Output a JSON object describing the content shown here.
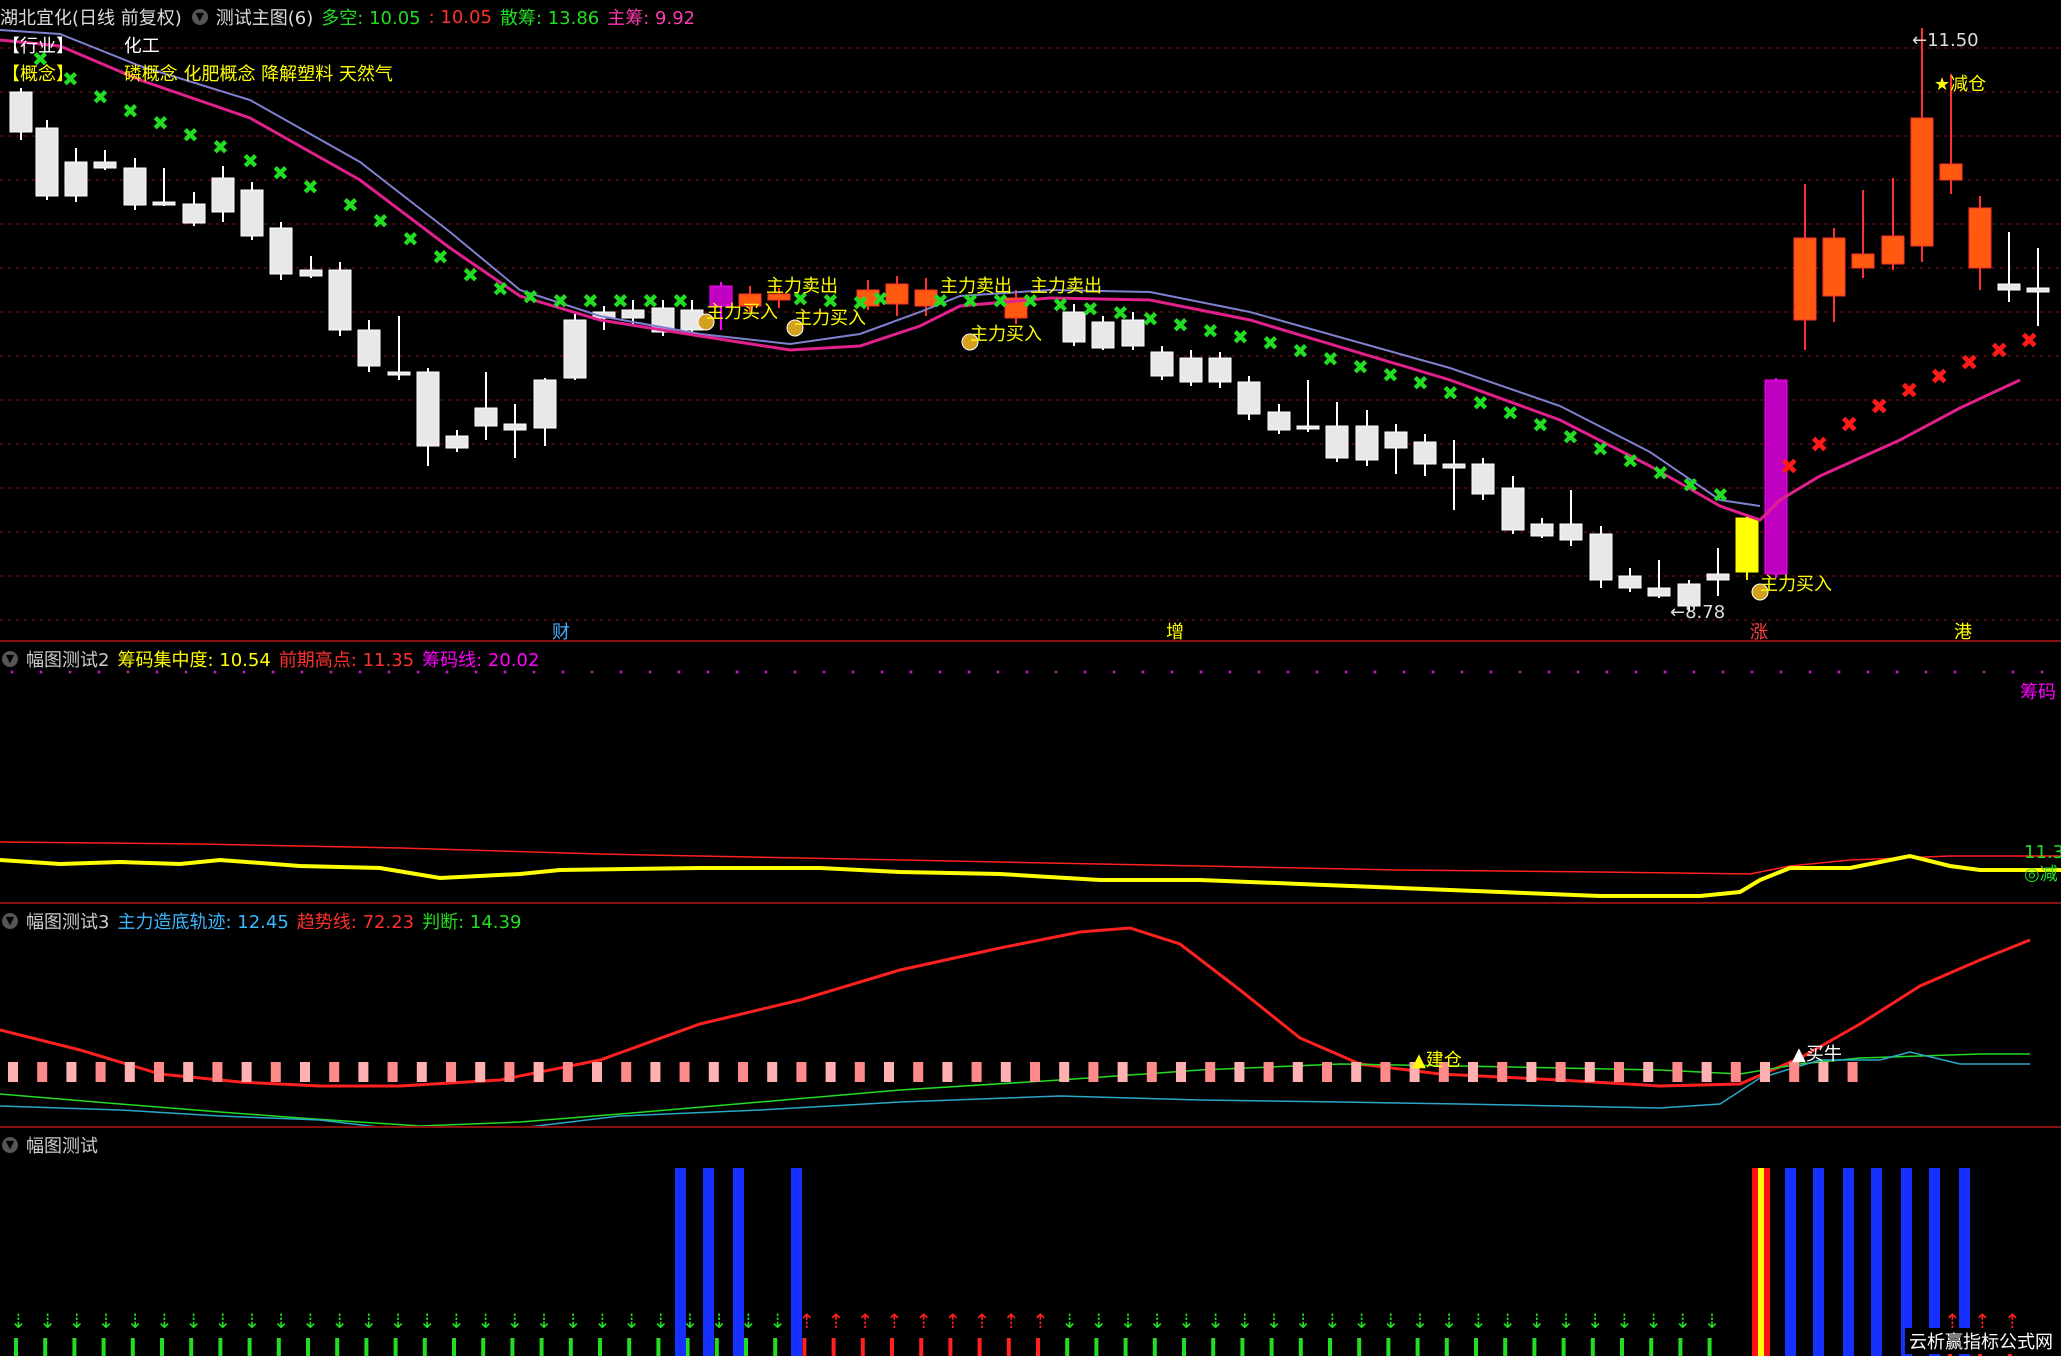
{
  "main_panel": {
    "stock_title": "湖北宜化(日线 前复权)",
    "indicator_name": "测试主图(6)",
    "duokong_label": "多空: 10.05",
    "duokong_val2": ": 10.05",
    "sanchou_label": "散筹: 13.86",
    "zhuchou_label": "主筹: 9.92",
    "industry_tag": "【行业】",
    "industry_value": "化工",
    "concept_tag": "【概念】",
    "concept_value": "磷概念 化肥概念 降解塑料 天然气",
    "high_label": "11.50",
    "low_label": "8.78",
    "reduce_label": "★减仓",
    "marks": [
      "主力卖出",
      "主力买入",
      "主力卖出",
      "主力买入",
      "主力卖出",
      "主力买入",
      "主力买入"
    ],
    "calendar_marks": [
      "财",
      "增",
      "涨",
      "港"
    ]
  },
  "panel2": {
    "name": "幅图测试2",
    "l1": "筹码集中度: 10.54",
    "l2": "前期高点: 11.35",
    "l3": "筹码线: 20.02",
    "right_tag": "筹码",
    "right_val": "11.3",
    "right_mark": "◎减"
  },
  "panel3": {
    "name": "幅图测试3",
    "l1": "主力造底轨迹: 12.45",
    "l2": "趋势线: 72.23",
    "l3": "判断: 14.39",
    "mark1": "▲建仓",
    "mark2": "▲买牛"
  },
  "panel4": {
    "name": "幅图测试"
  },
  "watermark": "云析赢指标公式网",
  "colors": {
    "up": "#ff3030",
    "down": "#ffffff",
    "ma_mag": "#e0208c",
    "ma_blue": "#8080d0",
    "green": "#22dd22",
    "yellow": "#ffff00",
    "magenta": "#ff00ff",
    "blue": "#1530ff"
  }
}
